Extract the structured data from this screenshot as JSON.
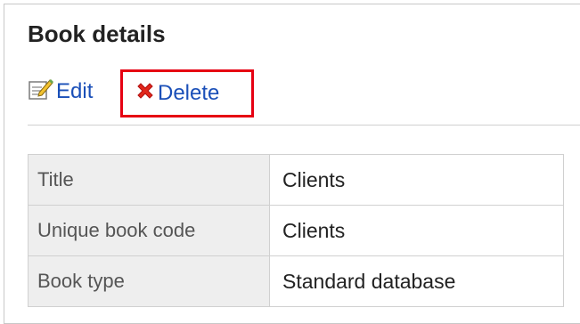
{
  "page": {
    "title": "Book details"
  },
  "toolbar": {
    "edit_label": "Edit",
    "edit_icon": "edit-icon",
    "delete_label": "Delete",
    "delete_icon": "delete-icon",
    "highlight_color": "#e60012",
    "link_color": "#1a4fb8"
  },
  "details": {
    "rows": [
      {
        "label": "Title",
        "value": "Clients"
      },
      {
        "label": "Unique book code",
        "value": "Clients"
      },
      {
        "label": "Book type",
        "value": "Standard database"
      }
    ]
  }
}
